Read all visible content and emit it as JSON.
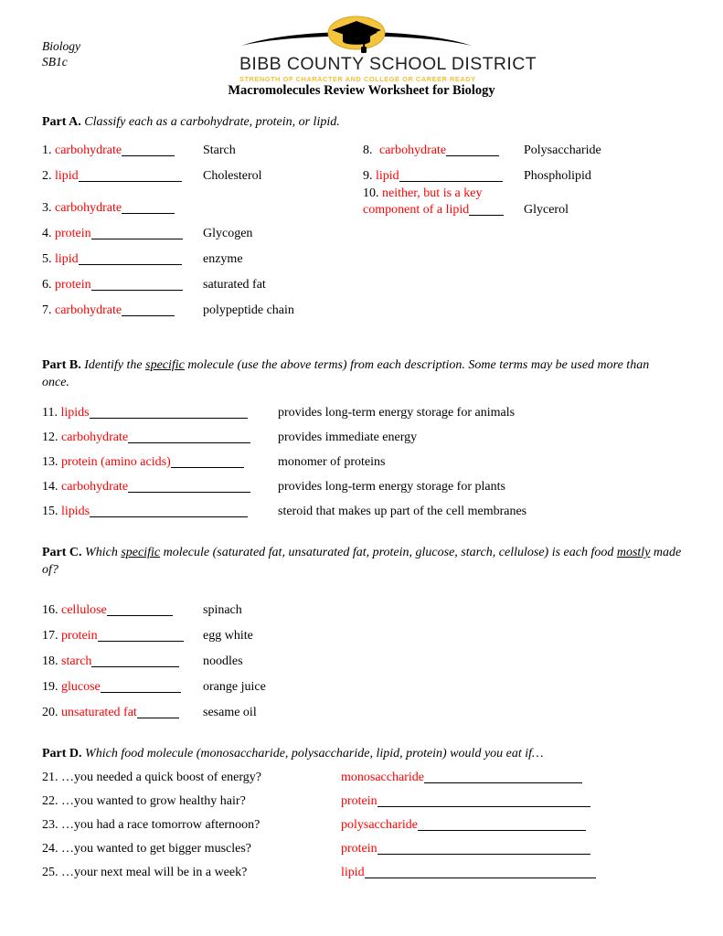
{
  "header": {
    "course": "Biology\nSB1c",
    "logo_name": "BIBB COUNTY SCHOOL DISTRICT",
    "logo_tagline": "STRENGTH OF CHARACTER AND COLLEGE OR CAREER READY",
    "title": "Macromolecules Review Worksheet for Biology",
    "logo_gold": "#f2c53d",
    "logo_black": "#000000"
  },
  "answer_color": "#ff0000",
  "parts": {
    "a": {
      "label": "Part A.",
      "instruction_pre": "Classify each as a ",
      "instruction": "Classify each as a carbohydrate, protein, or lipid.",
      "col1": [
        {
          "num": "1.",
          "answer": "carbohydrate",
          "term": "Starch"
        },
        {
          "num": "2.",
          "answer": "lipid",
          "term": "Cholesterol"
        },
        {
          "num": "3.",
          "answer": "carbohydrate",
          "term": ""
        },
        {
          "num": "4.",
          "answer": "protein",
          "term": "Glycogen"
        },
        {
          "num": "5.",
          "answer": "lipid",
          "term": "enzyme"
        },
        {
          "num": "6.",
          "answer": "protein",
          "term": "saturated fat"
        },
        {
          "num": "7.",
          "answer": "carbohydrate",
          "term": "polypeptide chain"
        }
      ],
      "col2": [
        {
          "num": "8.",
          "answer": "carbohydrate",
          "term": "Polysaccharide"
        },
        {
          "num": "9.",
          "answer": "lipid",
          "term": "Phospholipid"
        }
      ],
      "item10": {
        "num": "10.",
        "answer_line1": "neither, but is a key",
        "answer_line2": "component of a lipid",
        "term": "Glycerol"
      }
    },
    "b": {
      "label": "Part B.",
      "instruction_1": "Identify the ",
      "instruction_u": "specific",
      "instruction_2": " molecule (use the above terms) from each description. Some terms may be used more than once.",
      "items": [
        {
          "num": "11.",
          "answer": "lipids",
          "desc": "provides long-term energy storage for animals"
        },
        {
          "num": "12.",
          "answer": "carbohydrate",
          "desc": "provides immediate energy"
        },
        {
          "num": "13.",
          "answer": "protein (amino acids)",
          "desc": "monomer of proteins"
        },
        {
          "num": "14.",
          "answer": "carbohydrate",
          "desc": "provides long-term energy storage for plants"
        },
        {
          "num": "15.",
          "answer": "lipids",
          "desc": "steroid that makes up part of the cell membranes"
        }
      ]
    },
    "c": {
      "label": "Part C.",
      "instruction_1": "Which ",
      "instruction_u1": "specific",
      "instruction_2": " molecule (saturated fat, unsaturated fat, protein, glucose, starch, cellulose) is each food ",
      "instruction_u2": "mostly",
      "instruction_3": " made of?",
      "items": [
        {
          "num": "16.",
          "answer": "cellulose",
          "term": "spinach"
        },
        {
          "num": "17.",
          "answer": "protein",
          "term": "egg white"
        },
        {
          "num": "18.",
          "answer": "starch",
          "term": "noodles"
        },
        {
          "num": "19.",
          "answer": "glucose",
          "term": "orange juice"
        },
        {
          "num": "20.",
          "answer": "unsaturated fat",
          "term": "sesame oil"
        }
      ]
    },
    "d": {
      "label": "Part D.",
      "instruction": "Which food molecule (monosaccharide, polysaccharide, lipid, protein) would you eat if…",
      "items": [
        {
          "num": "21.",
          "question": "…you needed a quick boost of energy?",
          "answer": "monosaccharide"
        },
        {
          "num": "22.",
          "question": "…you wanted to grow healthy hair?",
          "answer": "protein"
        },
        {
          "num": "23.",
          "question": "…you had a race tomorrow afternoon?",
          "answer": "polysaccharide"
        },
        {
          "num": "24.",
          "question": "…you wanted to get bigger muscles?",
          "answer": "protein"
        },
        {
          "num": "25.",
          "question": "…your next meal will be in a week?",
          "answer": "lipid"
        }
      ]
    }
  }
}
